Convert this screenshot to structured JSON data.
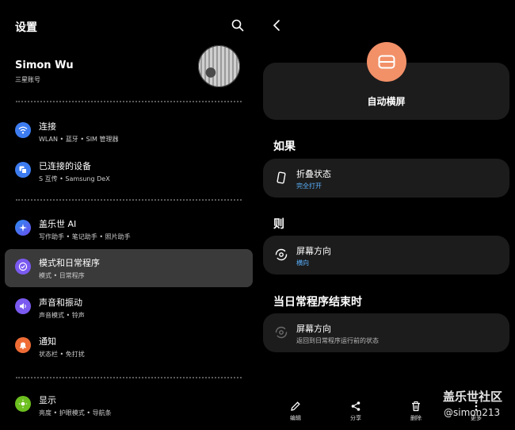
{
  "left": {
    "title": "设置",
    "profile": {
      "name": "Simon Wu",
      "sub": "三星账号"
    },
    "items": [
      {
        "title": "连接",
        "sub": "WLAN • 蓝牙 • SIM 管理器",
        "icon": "wifi-icon",
        "color": "#3d7cf0"
      },
      {
        "title": "已连接的设备",
        "sub": "S 互传 • Samsung DeX",
        "icon": "devices-icon",
        "color": "#3d7cf0"
      },
      {
        "title": "盖乐世 AI",
        "sub": "写作助手 • 笔记助手 • 照片助手",
        "icon": "ai-sparkle-icon",
        "color": "#3b6df0"
      },
      {
        "title": "模式和日常程序",
        "sub": "模式 • 日常程序",
        "icon": "modes-routines-icon",
        "color": "#7a5af0"
      },
      {
        "title": "声音和振动",
        "sub": "声音模式 • 铃声",
        "icon": "volume-icon",
        "color": "#7a5af0"
      },
      {
        "title": "通知",
        "sub": "状态栏 • 免打扰",
        "icon": "bell-icon",
        "color": "#ef6c36"
      },
      {
        "title": "显示",
        "sub": "亮度 • 护眼模式 • 导航条",
        "icon": "sun-icon",
        "color": "#6cbf1f"
      }
    ]
  },
  "right": {
    "hero_label": "自动横屏",
    "sections": {
      "if": "如果",
      "then": "则",
      "end": "当日常程序结束时"
    },
    "if_card": {
      "title": "折叠状态",
      "sub": "完全打开"
    },
    "then_card": {
      "title": "屏幕方向",
      "sub": "横向"
    },
    "end_card": {
      "title": "屏幕方向",
      "sub": "返回到日常程序运行前的状态"
    },
    "bottom_bar": [
      {
        "label": "编辑",
        "icon": "pencil-icon"
      },
      {
        "label": "分享",
        "icon": "share-icon"
      },
      {
        "label": "删除",
        "icon": "trash-icon"
      },
      {
        "label": "更多",
        "icon": "more-icon"
      }
    ]
  },
  "watermark": {
    "line1": "盖乐世社区",
    "line2": "@simon213"
  }
}
